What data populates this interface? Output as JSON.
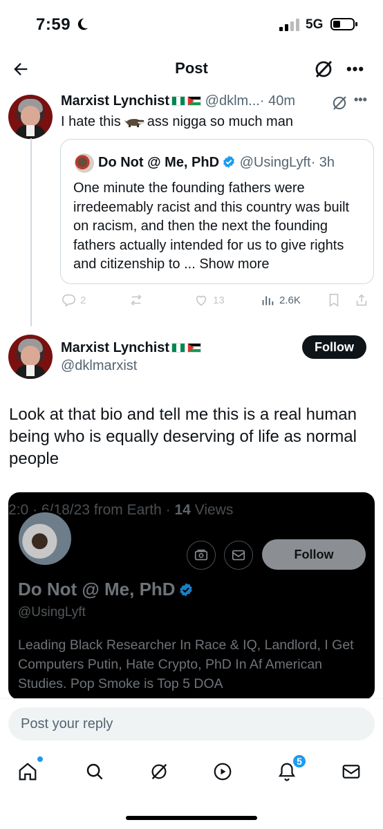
{
  "status_bar": {
    "time": "7:59",
    "network": "5G",
    "icons": [
      "moon-icon",
      "signal-icon",
      "battery-icon"
    ]
  },
  "nav": {
    "title": "Post",
    "icons": [
      "back-arrow-icon",
      "grok-icon",
      "more-icon"
    ]
  },
  "reply_tweet": {
    "name": "Marxist Lynchist",
    "handle": "@dklm...",
    "time": "· 40m",
    "text_before": "I hate this",
    "text_after": "ass nigga so much man",
    "emoji": "badger-emoji"
  },
  "quoted_tweet": {
    "name": "Do Not @ Me, PhD",
    "handle": "@UsingLyft",
    "time": "· 3h",
    "text": "One minute the founding fathers were irredeemably racist and this country was built on racism, and then the next the founding fathers actually intended for us to give rights and citizenship to ...",
    "show_more": "Show more"
  },
  "actions": {
    "replies": "2",
    "reposts": "",
    "likes": "13",
    "views": "2.6K"
  },
  "main_tweet": {
    "name": "Marxist Lynchist",
    "handle": "@dklmarxist",
    "follow_label": "Follow",
    "text": "Look at that bio and tell me this is a real human being who is equally deserving of life as normal people"
  },
  "embedded_screenshot": {
    "meta_prefix": "2:0",
    "meta_date": "· 6/18/23 from Earth ·",
    "meta_views_count": "14",
    "meta_views_label": "Views",
    "follow_label": "Follow",
    "name": "Do Not @ Me, PhD",
    "handle": "@UsingLyft",
    "bio": "Leading Black Researcher In Race & IQ, Landlord, I Get Computers Putin, Hate Crypto, PhD In Af American Studies. Pop Smoke is Top 5 DOA"
  },
  "reply_bar": {
    "placeholder": "Post your reply"
  },
  "tab_bar": {
    "tabs": [
      "home-icon",
      "search-icon",
      "grok-icon",
      "video-icon",
      "notifications-icon",
      "messages-icon"
    ],
    "notification_count": "5"
  },
  "colors": {
    "accent": "#1d9bf0",
    "text": "#0f1419",
    "secondary": "#536471",
    "border": "#cfd9de"
  }
}
